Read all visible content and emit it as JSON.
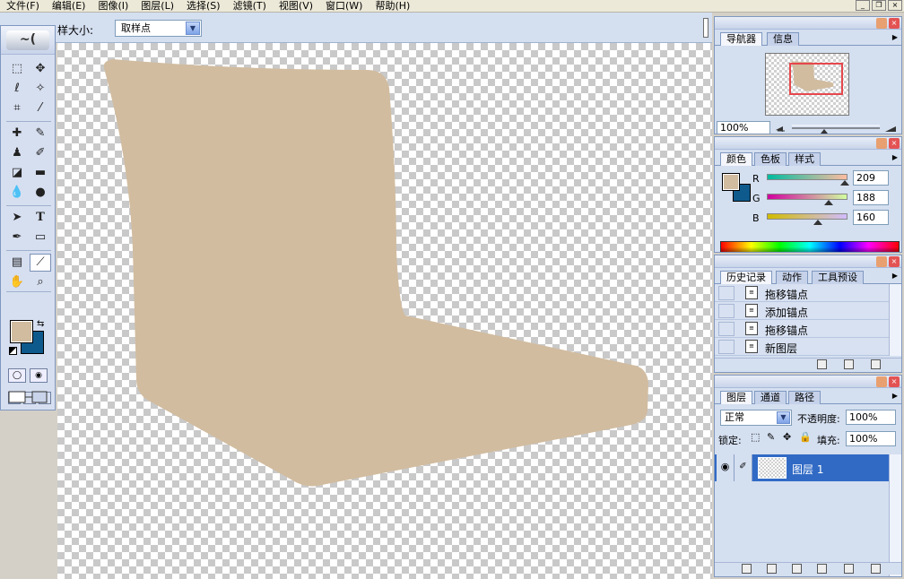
{
  "menu": {
    "items": [
      "文件(F)",
      "编辑(E)",
      "图像(I)",
      "图层(L)",
      "选择(S)",
      "滤镜(T)",
      "视图(V)",
      "窗口(W)",
      "帮助(H)"
    ],
    "window_controls": [
      "_",
      "❐",
      "×"
    ]
  },
  "options_bar": {
    "sample_size_label": "样大小:",
    "sample_size_value": "取样点"
  },
  "canvas": {
    "shape_fill": "#d1bca0"
  },
  "colors": {
    "foreground": "#d1bca0",
    "background": "#0f5a8c"
  },
  "navigator": {
    "tabs": [
      "导航器",
      "信息"
    ],
    "zoom": "100%"
  },
  "color_panel": {
    "tabs": [
      "颜色",
      "色板",
      "样式"
    ],
    "r_label": "R",
    "r_value": "209",
    "g_label": "G",
    "g_value": "188",
    "b_label": "B",
    "b_value": "160"
  },
  "history": {
    "tabs": [
      "历史记录",
      "动作",
      "工具预设"
    ],
    "items": [
      "拖移锚点",
      "添加锚点",
      "拖移锚点",
      "新图层"
    ]
  },
  "layers": {
    "tabs": [
      "图层",
      "通道",
      "路径"
    ],
    "blend_mode": "正常",
    "opacity_label": "不透明度:",
    "opacity_value": "100%",
    "lock_label": "锁定:",
    "fill_label": "填充:",
    "fill_value": "100%",
    "layer_name": "图层 1"
  }
}
